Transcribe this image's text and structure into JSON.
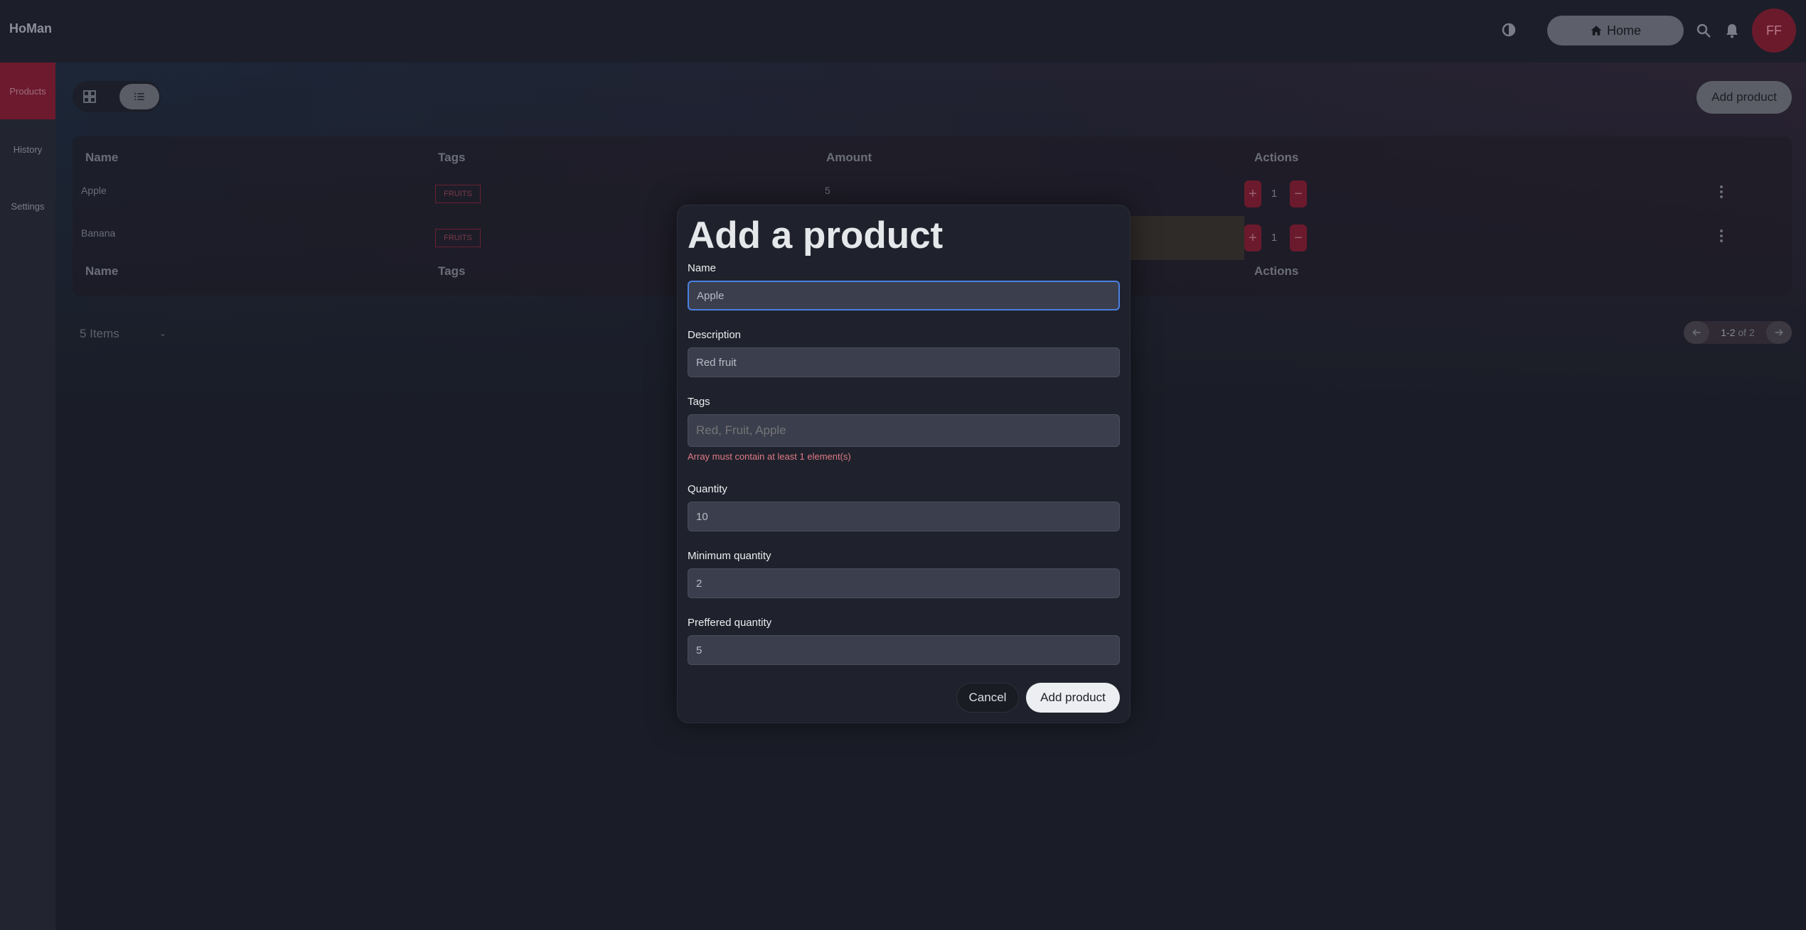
{
  "app": {
    "brand": "HoMan"
  },
  "header": {
    "home_label": "Home",
    "avatar_initials": "FF"
  },
  "sidebar": {
    "items": [
      {
        "label": "Products",
        "active": true
      },
      {
        "label": "History",
        "active": false
      },
      {
        "label": "Settings",
        "active": false
      }
    ]
  },
  "toolbar": {
    "add_product_label": "Add product"
  },
  "table": {
    "columns": [
      "Name",
      "Tags",
      "Amount",
      "Actions"
    ],
    "rows": [
      {
        "name": "Apple",
        "tag": "FRUITS",
        "amount": "5",
        "step": "1"
      },
      {
        "name": "Banana",
        "tag": "FRUITS",
        "amount": "",
        "step": "1"
      }
    ],
    "footer_columns": [
      "Name",
      "Tags",
      "Actions"
    ]
  },
  "pagination": {
    "items_per_page": "5 Items",
    "range": "1-2",
    "of_label": "of 2"
  },
  "modal": {
    "title": "Add a product",
    "fields": {
      "name": {
        "label": "Name",
        "value": "Apple"
      },
      "description": {
        "label": "Description",
        "value": "Red fruit"
      },
      "tags": {
        "label": "Tags",
        "placeholder": "Red, Fruit, Apple",
        "error": "Array must contain at least 1 element(s)"
      },
      "quantity": {
        "label": "Quantity",
        "value": "10"
      },
      "min_quantity": {
        "label": "Minimum quantity",
        "value": "2"
      },
      "pref_quantity": {
        "label": "Preffered quantity",
        "value": "5"
      }
    },
    "cancel_label": "Cancel",
    "submit_label": "Add product"
  },
  "colors": {
    "accent": "#6d1a2e",
    "focus": "#4a7fe0",
    "error": "#e07a86"
  }
}
